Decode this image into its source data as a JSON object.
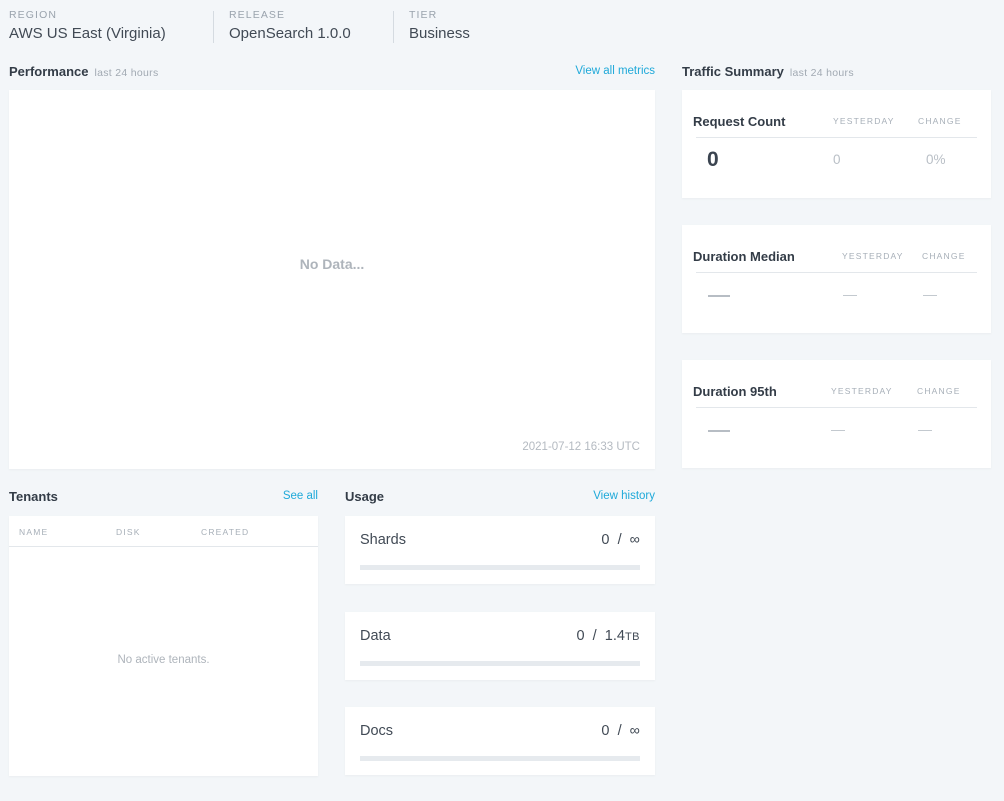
{
  "meta": [
    {
      "label": "REGION",
      "value": "AWS US East (Virginia)"
    },
    {
      "label": "RELEASE",
      "value": "OpenSearch 1.0.0"
    },
    {
      "label": "TIER",
      "value": "Business"
    }
  ],
  "performance": {
    "title": "Performance",
    "subtitle": "last 24 hours",
    "link": "View all metrics",
    "empty": "No Data...",
    "timestamp": "2021-07-12 16:33 UTC"
  },
  "traffic": {
    "title": "Traffic Summary",
    "subtitle": "last 24 hours",
    "yesterday_label": "YESTERDAY",
    "change_label": "CHANGE",
    "cards": [
      {
        "name": "Request Count",
        "value": "0",
        "yesterday": "0",
        "change": "0%"
      },
      {
        "name": "Duration Median",
        "value": "—",
        "yesterday": "—",
        "change": "—"
      },
      {
        "name": "Duration 95th",
        "value": "—",
        "yesterday": "—",
        "change": "—"
      }
    ]
  },
  "tenants": {
    "title": "Tenants",
    "link": "See all",
    "columns": [
      "NAME",
      "DISK",
      "CREATED"
    ],
    "empty": "No active tenants."
  },
  "usage": {
    "title": "Usage",
    "link": "View history",
    "items": [
      {
        "name": "Shards",
        "used": "0",
        "sep": "/",
        "limit": "∞",
        "unit": "",
        "fraction": 0
      },
      {
        "name": "Data",
        "used": "0",
        "sep": "/",
        "limit": "1.4",
        "unit": "TB",
        "fraction": 0
      },
      {
        "name": "Docs",
        "used": "0",
        "sep": "/",
        "limit": "∞",
        "unit": "",
        "fraction": 0
      }
    ]
  },
  "colors": {
    "accent": "#1fa9d9",
    "background": "#f3f6f9",
    "card": "#ffffff"
  }
}
